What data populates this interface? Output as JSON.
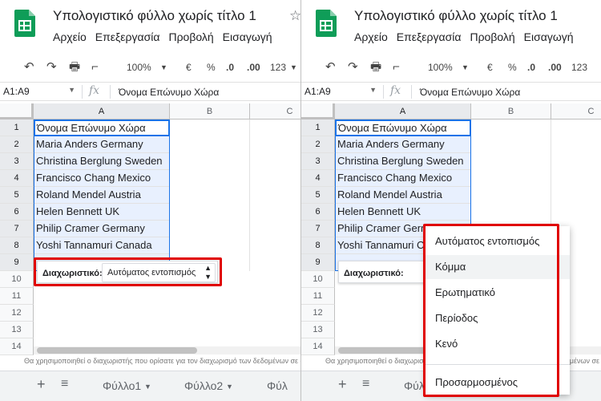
{
  "doc_title": "Υπολογιστικό φύλλο χωρίς τίτλο 1",
  "menu": [
    "Αρχείο",
    "Επεξεργασία",
    "Προβολή",
    "Εισαγωγή"
  ],
  "toolbar": {
    "zoom": "100%",
    "currency": "€",
    "percent": "%",
    "dec_less": ".0",
    "dec_more": ".00",
    "format": "123"
  },
  "formula_bar": {
    "namebox": "A1:A9",
    "fx": "fx",
    "content": "Όνομα Επώνυμο Χώρα"
  },
  "columns": [
    "A",
    "B",
    "C"
  ],
  "rows": [
    "1",
    "2",
    "3",
    "4",
    "5",
    "6",
    "7",
    "8",
    "9",
    "10",
    "11",
    "12",
    "13",
    "14"
  ],
  "cells_a": [
    "Όνομα Επώνυμο Χώρα",
    "Maria Anders Germany",
    "Christina Berglung Sweden",
    "Francisco Chang Mexico",
    "Roland Mendel Austria",
    "Helen Bennett UK",
    "Philip Cramer Germany",
    "Yoshi Tannamuri Canada"
  ],
  "separator": {
    "label": "Διαχωριστικό:",
    "selected": "Αυτόματος εντοπισμός"
  },
  "dropdown_options": [
    "Αυτόματος εντοπισμός",
    "Κόμμα",
    "Ερωτηματικό",
    "Περίοδος",
    "Κενό",
    "Προσαρμοσμένος"
  ],
  "hint": "Θα χρησιμοποιηθεί ο διαχωριστής που ορίσατε για τον διαχωρισμό των δεδομένων σε στήλες που θα εφαρμοστεί",
  "sheets": [
    "Φύλλο1",
    "Φύλλο2",
    "Φύλ"
  ],
  "colors": {
    "accent": "#1a73e8",
    "highlight": "#e00000",
    "logo": "#0f9d58"
  }
}
